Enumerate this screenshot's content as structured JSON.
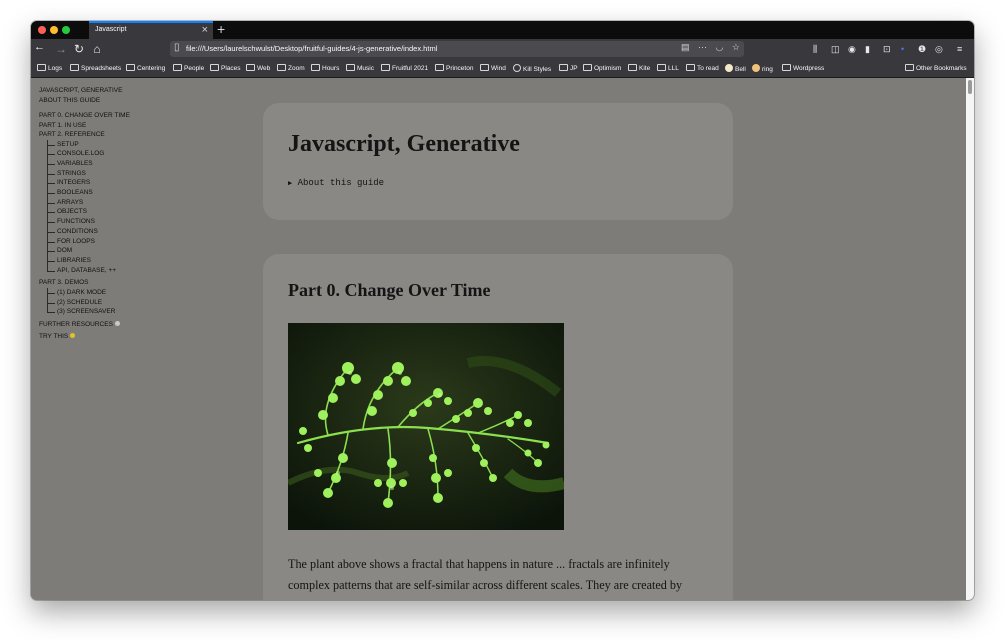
{
  "browser": {
    "tab_title": "Javascript",
    "url": "file:///Users/laurelschwulst/Desktop/fruitful-guides/4-js-generative/index.html"
  },
  "bookmarks": [
    {
      "label": "Logs",
      "icon": "folder-icon"
    },
    {
      "label": "Spreadsheets",
      "icon": "folder-icon"
    },
    {
      "label": "Centering",
      "icon": "folder-icon"
    },
    {
      "label": "People",
      "icon": "folder-icon"
    },
    {
      "label": "Places",
      "icon": "folder-icon"
    },
    {
      "label": "Web",
      "icon": "folder-icon"
    },
    {
      "label": "Zoom",
      "icon": "folder-icon"
    },
    {
      "label": "Hours",
      "icon": "folder-icon"
    },
    {
      "label": "Music",
      "icon": "folder-icon"
    },
    {
      "label": "Fruitful 2021",
      "icon": "folder-icon"
    },
    {
      "label": "Princeton",
      "icon": "folder-icon"
    },
    {
      "label": "Wind",
      "icon": "folder-icon"
    },
    {
      "label": "Kill Styles",
      "icon": "globe-icon"
    },
    {
      "label": "JP",
      "icon": "folder-icon"
    },
    {
      "label": "Optimism",
      "icon": "folder-icon"
    },
    {
      "label": "Kite",
      "icon": "folder-icon"
    },
    {
      "label": "LLL",
      "icon": "folder-icon"
    },
    {
      "label": "To read",
      "icon": "folder-icon"
    },
    {
      "label": "Bell",
      "icon": "bell-icon"
    },
    {
      "label": "ring",
      "icon": "ring-icon"
    },
    {
      "label": "Wordpress",
      "icon": "folder-icon"
    },
    {
      "label": "Other Bookmarks",
      "icon": "folder-icon"
    }
  ],
  "sidebar": {
    "title": "JAVASCRIPT, GENERATIVE",
    "about": "ABOUT THIS GUIDE",
    "part0": "PART 0. CHANGE OVER TIME",
    "part1": "PART 1. IN USE",
    "part2": "PART 2. REFERENCE",
    "reference_items": [
      "SETUP",
      "CONSOLE.LOG",
      "VARIABLES",
      "STRINGS",
      "INTEGERS",
      "BOOLEANS",
      "ARRAYS",
      "OBJECTS",
      "FUNCTIONS",
      "CONDITIONS",
      "FOR LOOPS",
      "DOM",
      "LIBRARIES",
      "API, DATABASE, ++"
    ],
    "part3": "PART 3. DEMOS",
    "demo_items": [
      "(1) DARK MODE",
      "(2) SCHEDULE",
      "(3) SCREENSAVER"
    ],
    "further": "FURTHER RESOURCES",
    "try": "TRY THIS"
  },
  "main": {
    "title": "Javascript, Generative",
    "details_label": "About this guide",
    "section_heading": "Part 0. Change Over Time",
    "paragraph": "The plant above shows a fractal that happens in nature ... fractals are infinitely complex patterns that are self-similar across different scales. They are created by repeating a simple process over and over in an ongoing feedback loop."
  },
  "colors": {
    "page_background": "#7d7c78",
    "card_background": "#8a8884",
    "toolbar": "#38383d",
    "tabbar": "#0c0c0d"
  }
}
